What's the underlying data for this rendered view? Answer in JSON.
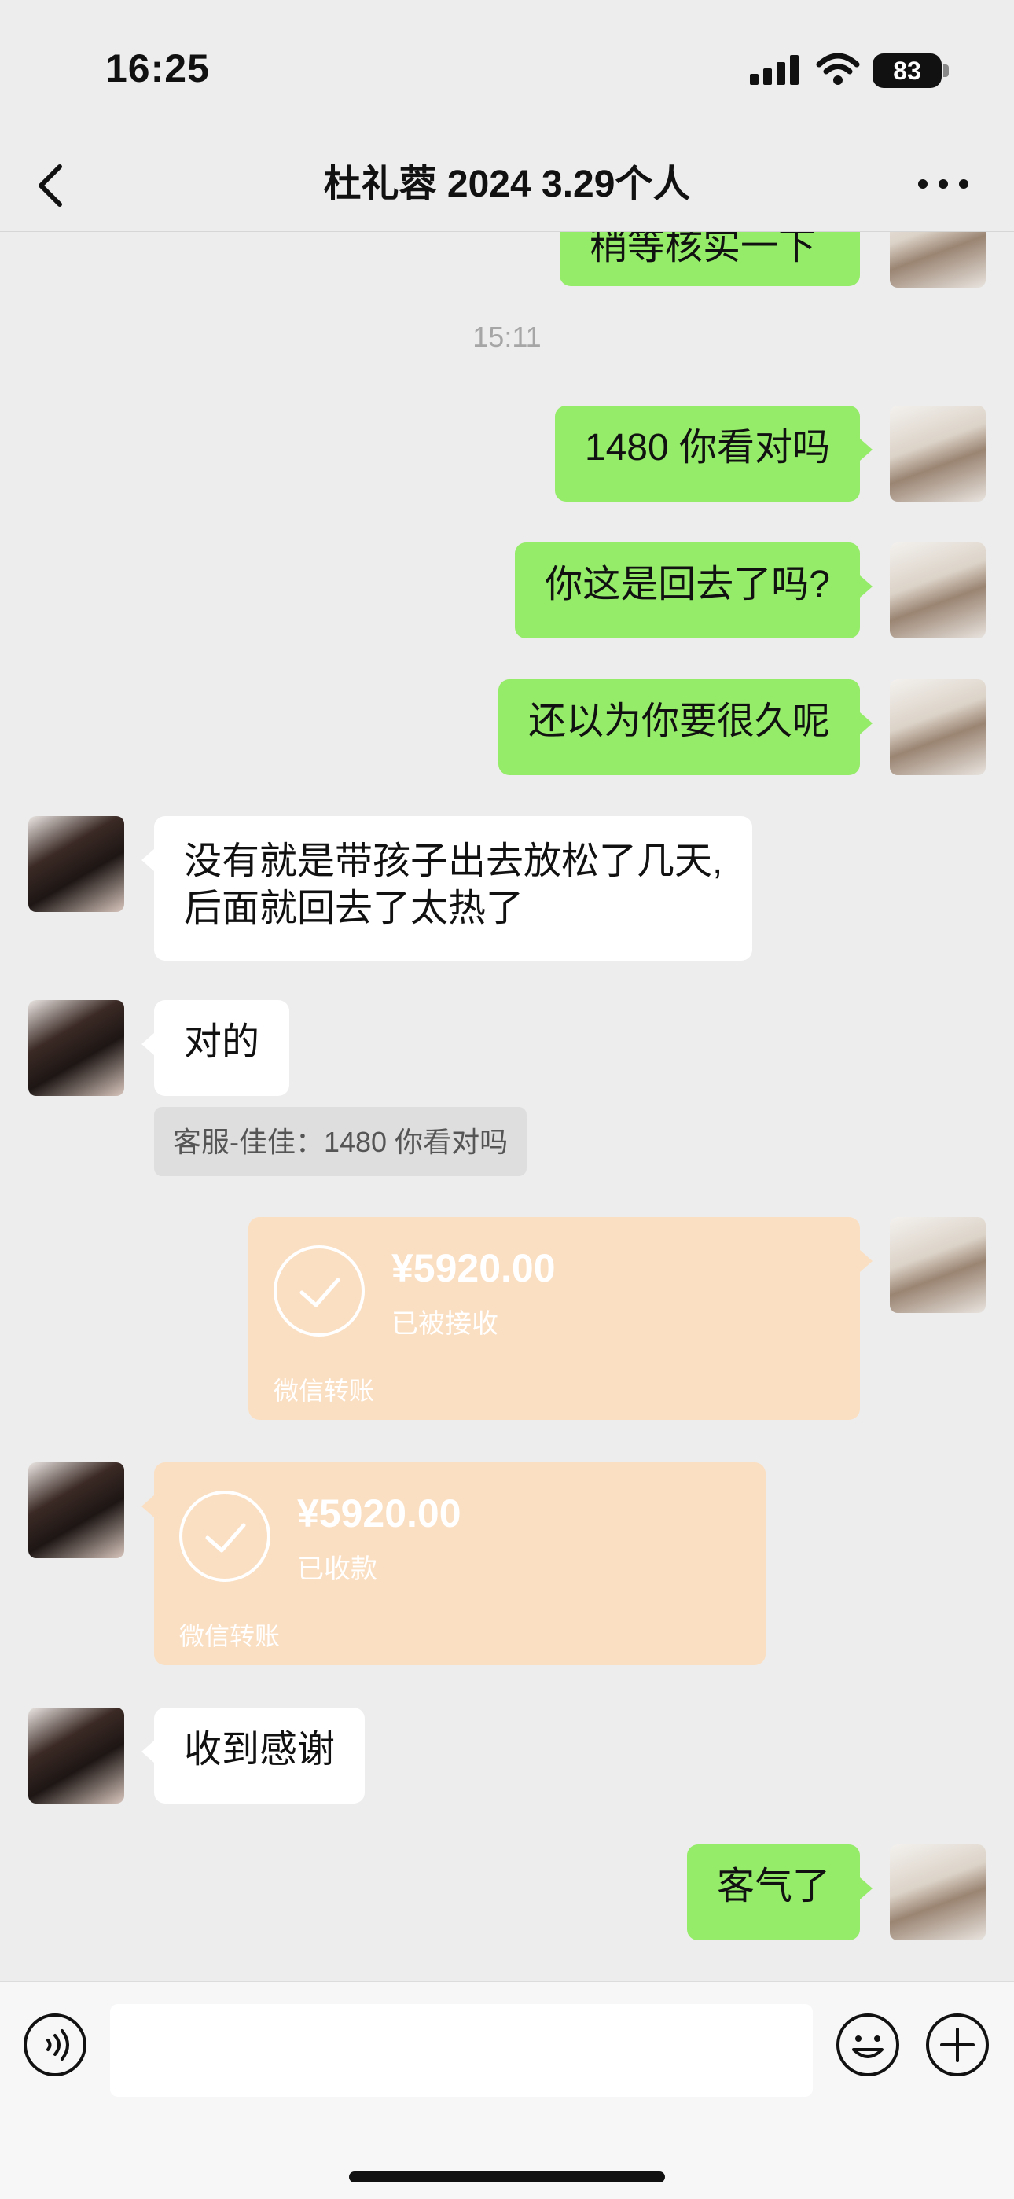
{
  "status_bar": {
    "time": "16:25",
    "battery": "83"
  },
  "nav": {
    "title": "杜礼蓉 2024  3.29个人"
  },
  "messages": {
    "partial_top": "稍等核实一下",
    "timestamp": "15:11",
    "out1": "1480 你看对吗",
    "out2": "你这是回去了吗?",
    "out3": "还以为你要很久呢",
    "in1_line1": "没有就是带孩子出去放松了几天,",
    "in1_line2": "后面就回去了太热了",
    "in2": "对的",
    "quote": "客服-佳佳：1480 你看对吗",
    "transfer_out": {
      "amount": "¥5920.00",
      "status": "已被接收",
      "label": "微信转账"
    },
    "transfer_in": {
      "amount": "¥5920.00",
      "status": "已收款",
      "label": "微信转账"
    },
    "in3": "收到感谢",
    "out4": "客气了"
  },
  "input": {
    "placeholder": ""
  },
  "colors": {
    "outgoing_bubble": "#95ec69",
    "incoming_bubble": "#ffffff",
    "transfer_card": "#fbdfc2",
    "background": "#ededed"
  },
  "icons": [
    "back-icon",
    "more-icon",
    "voice-icon",
    "emoji-icon",
    "plus-icon",
    "check-icon",
    "signal-icon",
    "wifi-icon"
  ]
}
